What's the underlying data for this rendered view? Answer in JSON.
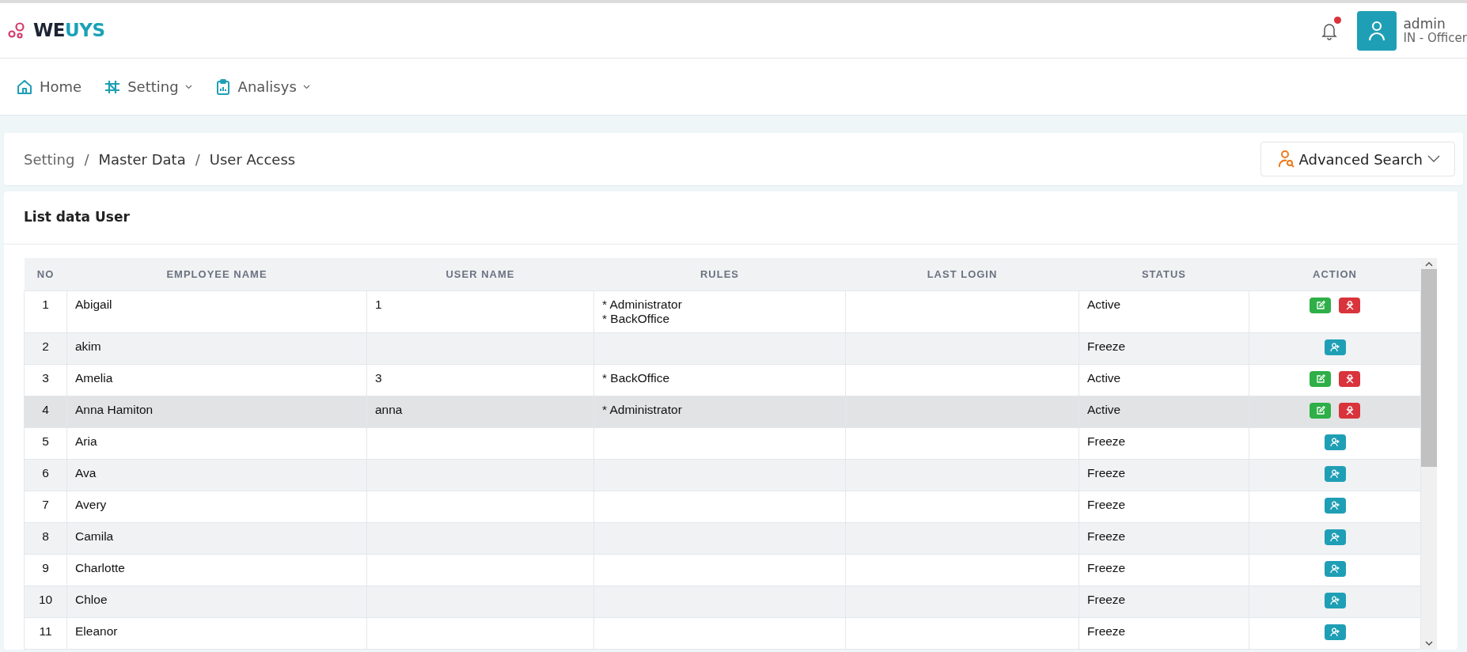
{
  "brand": {
    "part_1": "WE",
    "part_2": "UYS"
  },
  "header": {
    "notification_unread": true,
    "user_name": "admin",
    "user_role": "IN - Officer"
  },
  "nav": [
    {
      "label": "Home",
      "dropdown": false
    },
    {
      "label": "Setting",
      "dropdown": true
    },
    {
      "label": "Analisys",
      "dropdown": true
    }
  ],
  "breadcrumb": [
    {
      "kind": "link",
      "text": "Setting"
    },
    {
      "kind": "separator",
      "text": "/"
    },
    {
      "kind": "link",
      "text": "Master Data"
    },
    {
      "kind": "separator",
      "text": "/"
    },
    {
      "kind": "current",
      "text": "User Access"
    }
  ],
  "advanced_search": {
    "label": "Advanced Search"
  },
  "card_title": "List data User",
  "table": {
    "columns": [
      "NO",
      "EMPLOYEE NAME",
      "USER NAME",
      "RULES",
      "LAST LOGIN",
      "STATUS",
      "ACTION"
    ],
    "rows": [
      {
        "no": "1",
        "employee_name": "Abigail",
        "user_name": "1",
        "rules": [
          "* Administrator",
          "* BackOffice"
        ],
        "status": "Active",
        "actions": [
          {
            "kind": "edit"
          },
          {
            "kind": "deactivate"
          }
        ],
        "highlighted": false
      },
      {
        "no": "2",
        "employee_name": "akim",
        "rules": [],
        "status": "Freeze",
        "actions": [
          {
            "kind": "add_user"
          }
        ],
        "highlighted": false
      },
      {
        "no": "3",
        "employee_name": "Amelia",
        "user_name": "3",
        "rules": [
          "* BackOffice"
        ],
        "status": "Active",
        "actions": [
          {
            "kind": "edit"
          },
          {
            "kind": "deactivate"
          }
        ],
        "highlighted": false
      },
      {
        "no": "4",
        "employee_name": "Anna Hamiton",
        "user_name": "anna",
        "rules": [
          "* Administrator"
        ],
        "status": "Active",
        "actions": [
          {
            "kind": "edit"
          },
          {
            "kind": "deactivate"
          }
        ],
        "highlighted": true
      },
      {
        "no": "5",
        "employee_name": "Aria",
        "rules": [],
        "status": "Freeze",
        "actions": [
          {
            "kind": "add_user"
          }
        ],
        "highlighted": false
      },
      {
        "no": "6",
        "employee_name": "Ava",
        "rules": [],
        "status": "Freeze",
        "actions": [
          {
            "kind": "add_user"
          }
        ],
        "highlighted": false
      },
      {
        "no": "7",
        "employee_name": "Avery",
        "rules": [],
        "status": "Freeze",
        "actions": [
          {
            "kind": "add_user"
          }
        ],
        "highlighted": false
      },
      {
        "no": "8",
        "employee_name": "Camila",
        "rules": [],
        "status": "Freeze",
        "actions": [
          {
            "kind": "add_user"
          }
        ],
        "highlighted": false
      },
      {
        "no": "9",
        "employee_name": "Charlotte",
        "rules": [],
        "status": "Freeze",
        "actions": [
          {
            "kind": "add_user"
          }
        ],
        "highlighted": false
      },
      {
        "no": "10",
        "employee_name": "Chloe",
        "rules": [],
        "status": "Freeze",
        "actions": [
          {
            "kind": "add_user"
          }
        ],
        "highlighted": false
      },
      {
        "no": "11",
        "employee_name": "Eleanor",
        "rules": [],
        "status": "Freeze",
        "actions": [
          {
            "kind": "add_user"
          }
        ],
        "highlighted": false
      }
    ]
  }
}
